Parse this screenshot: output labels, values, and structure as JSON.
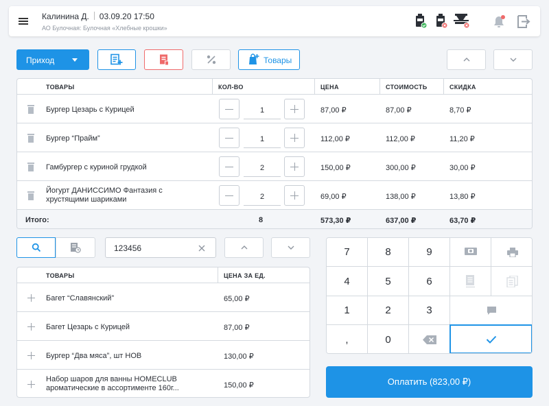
{
  "header": {
    "user": "Калинина Д.",
    "datetime": "03.09.20 17:50",
    "org": "АО Булочная: Булочная «Хлебные крошки»"
  },
  "toolbar": {
    "mode_label": "Приход",
    "goods_label": "Товары"
  },
  "cart": {
    "columns": [
      "ТОВАРЫ",
      "КОЛ-ВО",
      "ЦЕНА",
      "СТОИМОСТЬ",
      "СКИДКА"
    ],
    "rows": [
      {
        "name": "Бургер Цезарь с Курицей",
        "name2": "",
        "qty": "1",
        "price": "87,00 ₽",
        "cost": "87,00 ₽",
        "discount": "8,70 ₽"
      },
      {
        "name": "Бургер “Прайм”",
        "name2": "",
        "qty": "1",
        "price": "112,00 ₽",
        "cost": "112,00 ₽",
        "discount": "11,20 ₽"
      },
      {
        "name": "Гамбургер с куриной грудкой",
        "name2": "",
        "qty": "2",
        "price": "150,00 ₽",
        "cost": "300,00 ₽",
        "discount": "30,00 ₽"
      },
      {
        "name": "Йогурт ДАНИССИМО Фантазия с",
        "name2": "хрустящими шариками",
        "qty": "2",
        "price": "69,00 ₽",
        "cost": "138,00 ₽",
        "discount": "13,80 ₽"
      }
    ],
    "total": {
      "label": "Итого:",
      "qty": "8",
      "price": "573,30 ₽",
      "cost": "637,00 ₽",
      "discount": "63,70 ₽"
    }
  },
  "search": {
    "value": "123456"
  },
  "catalog": {
    "columns": [
      "ТОВАРЫ",
      "ЦЕНА ЗА ЕД."
    ],
    "rows": [
      {
        "name": "Багет “Славянский”",
        "name2": "",
        "price": "65,00 ₽"
      },
      {
        "name": "Багет Цезарь с Курицей",
        "name2": "",
        "price": "87,00 ₽"
      },
      {
        "name": "Бургер “Два мяса”, шт НОВ",
        "name2": "",
        "price": "130,00 ₽"
      },
      {
        "name": "Набор шаров для ванны HOMECLUB",
        "name2": "ароматические в ассортименте 160г...",
        "price": "150,00 ₽"
      }
    ]
  },
  "keypad": {
    "k7": "7",
    "k8": "8",
    "k9": "9",
    "k4": "4",
    "k5": "5",
    "k6": "6",
    "k1": "1",
    "k2": "2",
    "k3": "3",
    "kcomma": ",",
    "k0": "0"
  },
  "pay_label": "Оплатить (823,00 ₽)",
  "colors": {
    "accent": "#1e93e6",
    "danger": "#ef6a6a",
    "success": "#3cb55a"
  }
}
